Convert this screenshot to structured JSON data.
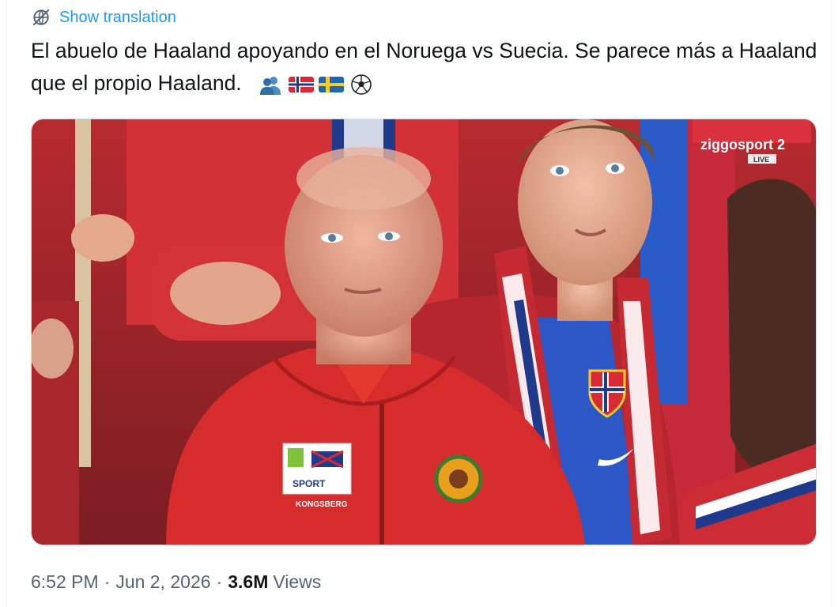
{
  "translate": {
    "label": "Show translation",
    "icon": "globe-translate-icon"
  },
  "tweet": {
    "text": "El abuelo de Haaland apoyando en el Noruega vs Suecia. Se parece más a Haaland que el propio Haaland.",
    "emojis": [
      "people-icon",
      "norway-flag-icon",
      "sweden-flag-icon",
      "soccer-ball-icon"
    ]
  },
  "media": {
    "description": "photo-of-fans-in-stadium",
    "broadcaster_logo": "ziggosport 2",
    "broadcaster_sub": "LIVE",
    "jacket_badge_text_top": "SPORT",
    "jacket_badge_text_bottom": "KONGSBERG"
  },
  "meta": {
    "time": "6:52 PM",
    "separator": "·",
    "date": "Jun 2, 2026",
    "views_count": "3.6M",
    "views_label": "Views"
  },
  "colors": {
    "link": "#1d9bf0",
    "text": "#0f1419",
    "muted": "#536471",
    "norway_red": "#d62b34",
    "norway_blue": "#1f3a8a"
  }
}
